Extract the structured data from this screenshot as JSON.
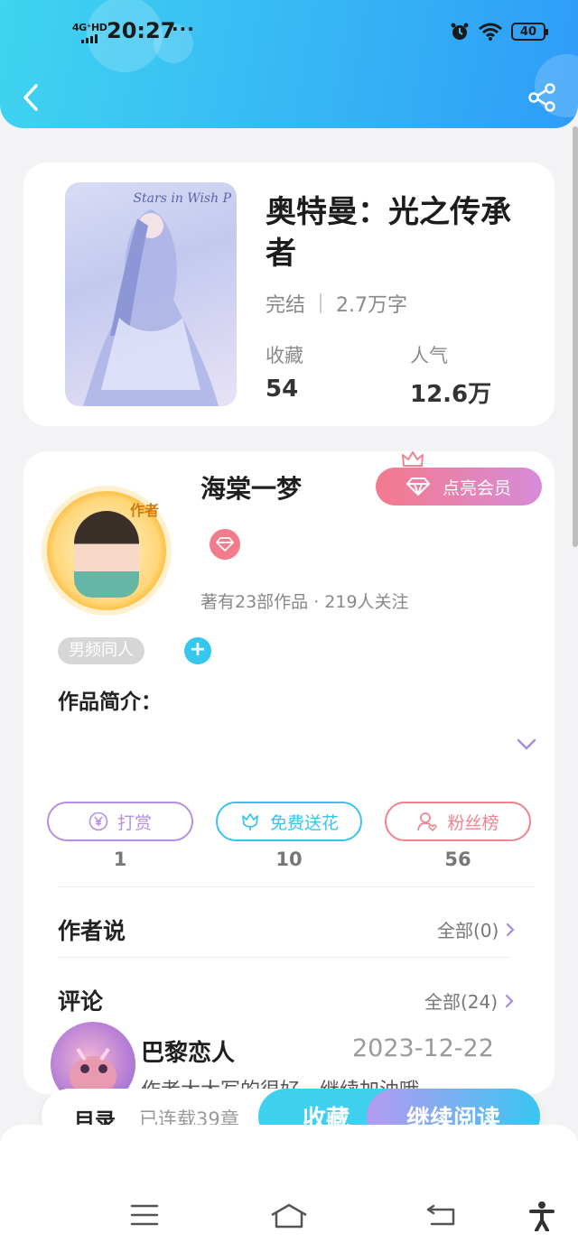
{
  "status_bar": {
    "network": "4G⁺HD",
    "time": "20:27",
    "more": "···",
    "battery": "40"
  },
  "header": {
    "back_icon": "chevron-left-icon",
    "share_icon": "share-icon"
  },
  "book": {
    "cover_text": "Stars in Wish P",
    "title": "奥特曼：光之传承者",
    "status": "完结",
    "word_count": "2.7万字",
    "favorites_label": "收藏",
    "favorites_value": "54",
    "popularity_label": "人气",
    "popularity_value": "12.6万"
  },
  "author": {
    "badge": "作者",
    "name": "海棠一梦",
    "vip_button": "点亮会员",
    "stats": "著有23部作品 · 219人关注",
    "tag": "男频同人",
    "tag_add": "+"
  },
  "intro": {
    "label": "作品简介："
  },
  "actions": [
    {
      "label": "打赏",
      "count": "1",
      "color": "#b58ee6"
    },
    {
      "label": "免费送花",
      "count": "10",
      "color": "#39c4ee"
    },
    {
      "label": "粉丝榜",
      "count": "56",
      "color": "#f0838f"
    }
  ],
  "author_says": {
    "title": "作者说",
    "link": "全部(0)"
  },
  "comments": {
    "title": "评论",
    "link": "全部(24)",
    "first": {
      "user": "巴黎恋人",
      "date": "2023-12-22",
      "text": "作者大大写的很好，继续加油哦"
    }
  },
  "bottom_bar": {
    "toc": "目录",
    "chapters": "已连载39章",
    "favorite": "收藏",
    "continue": "继续阅读"
  },
  "nav": {
    "menu": "menu-icon",
    "home": "home-icon",
    "back": "back-icon",
    "accessibility": "accessibility-icon"
  }
}
